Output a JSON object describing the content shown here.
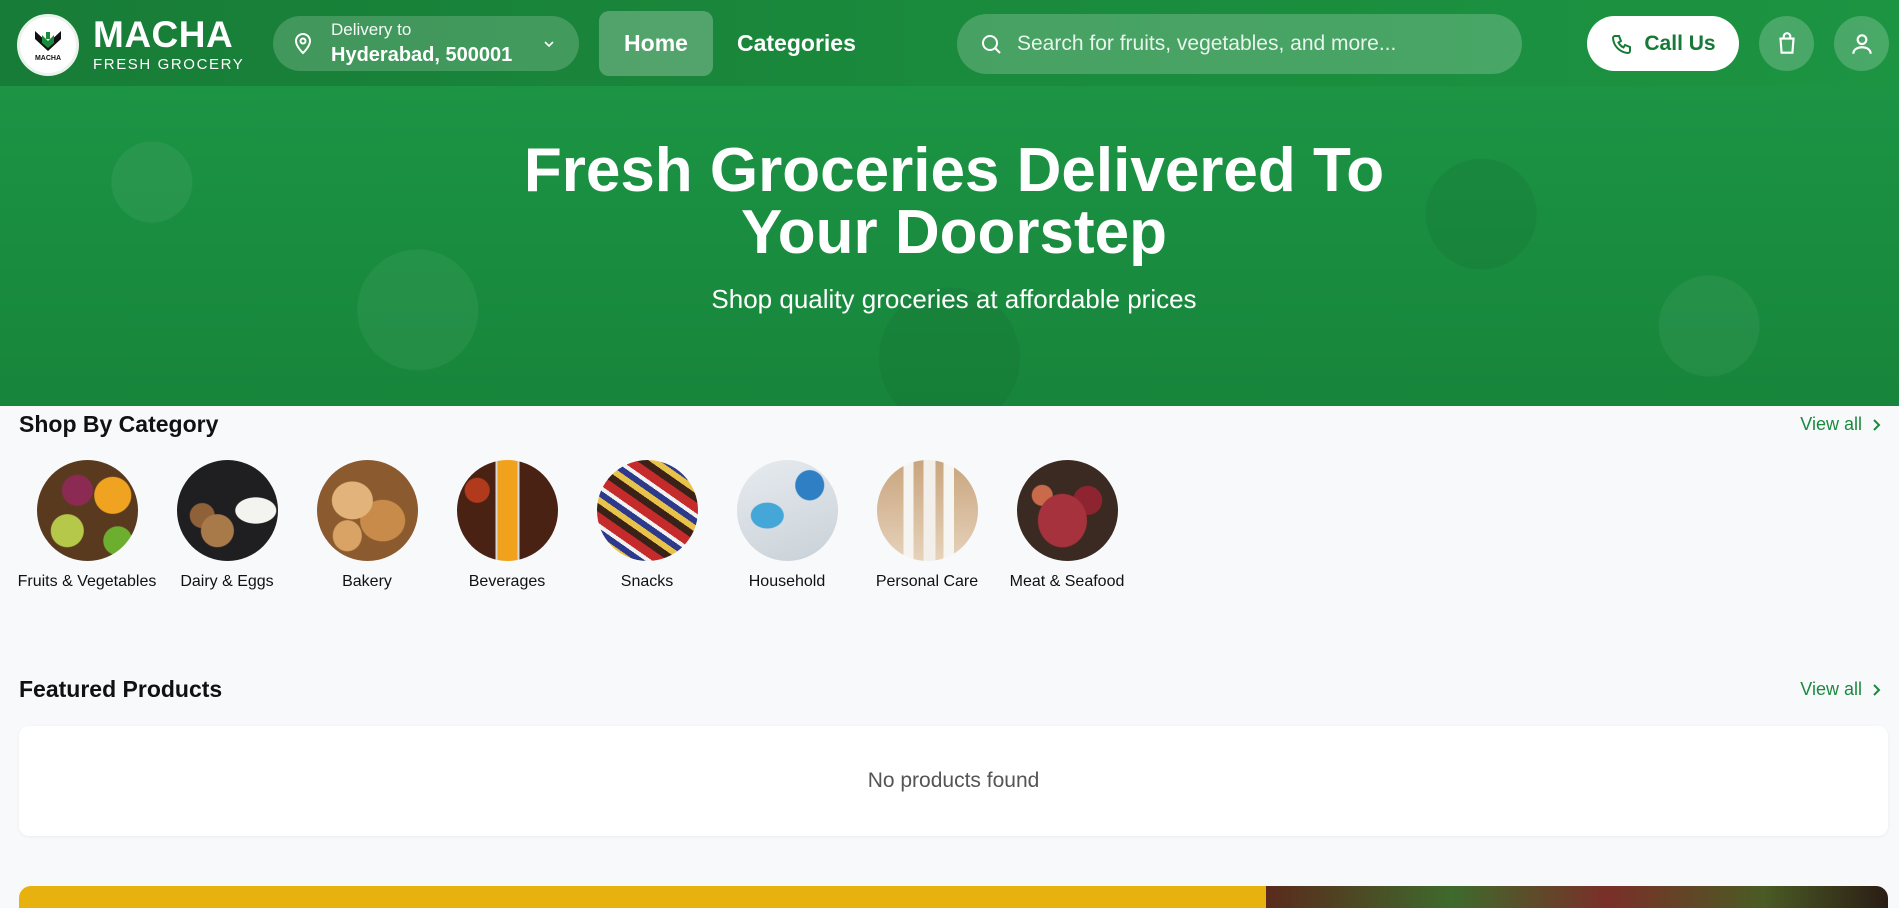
{
  "header": {
    "brand": "MACHA",
    "brand_sub": "FRESH GROCERY",
    "logo_mini": "MACHA",
    "delivery_label": "Delivery to",
    "delivery_city": "Hyderabad, 500001",
    "nav": {
      "home": "Home",
      "categories": "Categories"
    },
    "search_placeholder": "Search for fruits, vegetables, and more...",
    "call_label": "Call Us"
  },
  "hero": {
    "title_line1": "Fresh Groceries Delivered To",
    "title_line2": "Your Doorstep",
    "subtitle": "Shop quality groceries at affordable prices"
  },
  "categories_section": {
    "title": "Shop By Category",
    "view_all": "View all",
    "items": [
      {
        "label": "Fruits & Vegetables"
      },
      {
        "label": "Dairy & Eggs"
      },
      {
        "label": "Bakery"
      },
      {
        "label": "Beverages"
      },
      {
        "label": "Snacks"
      },
      {
        "label": "Household"
      },
      {
        "label": "Personal Care"
      },
      {
        "label": "Meat & Seafood"
      }
    ]
  },
  "featured_section": {
    "title": "Featured Products",
    "view_all": "View all",
    "empty_text": "No products found"
  },
  "colors": {
    "brand_green": "#1a8a3c",
    "link_green": "#1b8a3f",
    "promo_yellow": "#e8b20e"
  }
}
